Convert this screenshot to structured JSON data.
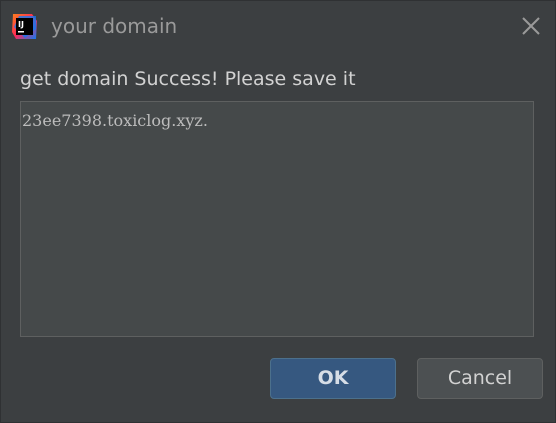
{
  "window": {
    "title": "your domain",
    "app_icon": "intellij-idea-icon",
    "close_icon": "close-icon"
  },
  "dialog": {
    "message": "get domain Success! Please save it",
    "domain_value": "23ee7398.toxiclog.xyz."
  },
  "buttons": {
    "ok_label": "OK",
    "cancel_label": "Cancel"
  },
  "colors": {
    "background": "#3c3f41",
    "text_area_bg": "#45494a",
    "primary_button": "#365880",
    "secondary_button": "#4c5052"
  }
}
